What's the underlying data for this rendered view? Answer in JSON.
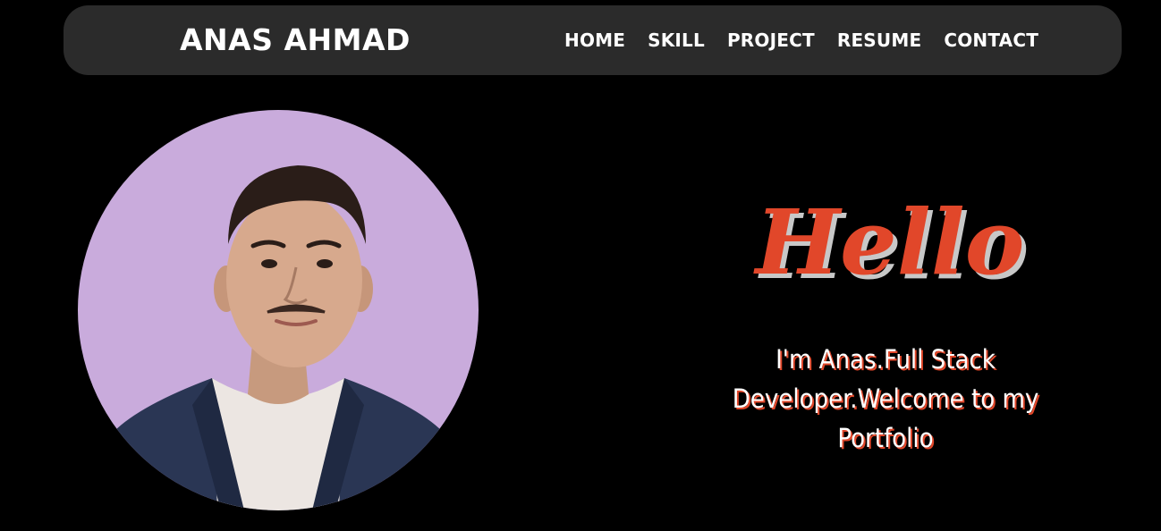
{
  "nav": {
    "brand": "ANAS AHMAD",
    "links": [
      {
        "label": "HOME"
      },
      {
        "label": "SKILL"
      },
      {
        "label": "PROJECT"
      },
      {
        "label": "RESUME"
      },
      {
        "label": "CONTACT"
      }
    ]
  },
  "hero": {
    "greeting": "Hello",
    "tagline": "I'm Anas.Full Stack Developer.Welcome to my Portfolio",
    "photo_icon": "profile-photo"
  },
  "colors": {
    "background": "#000000",
    "navbar": "#2b2b2b",
    "accent": "#e1472a",
    "avatar_bg": "#c9abdc"
  }
}
